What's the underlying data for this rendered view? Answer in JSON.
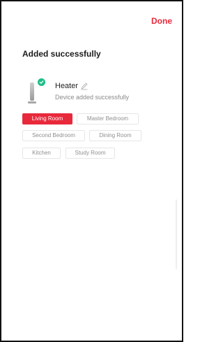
{
  "header": {
    "done_label": "Done"
  },
  "page": {
    "title": "Added successfully"
  },
  "device": {
    "name": "Heater",
    "status": "Device added successfully",
    "image_icon": "heater-icon",
    "badge_icon": "check-circle-icon",
    "edit_icon": "pencil-icon"
  },
  "rooms": {
    "items": [
      {
        "label": "Living Room",
        "selected": true
      },
      {
        "label": "Master Bedroom",
        "selected": false
      },
      {
        "label": "Second Bedroom",
        "selected": false
      },
      {
        "label": "Dining Room",
        "selected": false
      },
      {
        "label": "Kitchen",
        "selected": false
      },
      {
        "label": "Study Room",
        "selected": false
      }
    ]
  },
  "colors": {
    "accent": "#e8293b",
    "success": "#1fbf8a",
    "muted_text": "#8f8f8f"
  }
}
